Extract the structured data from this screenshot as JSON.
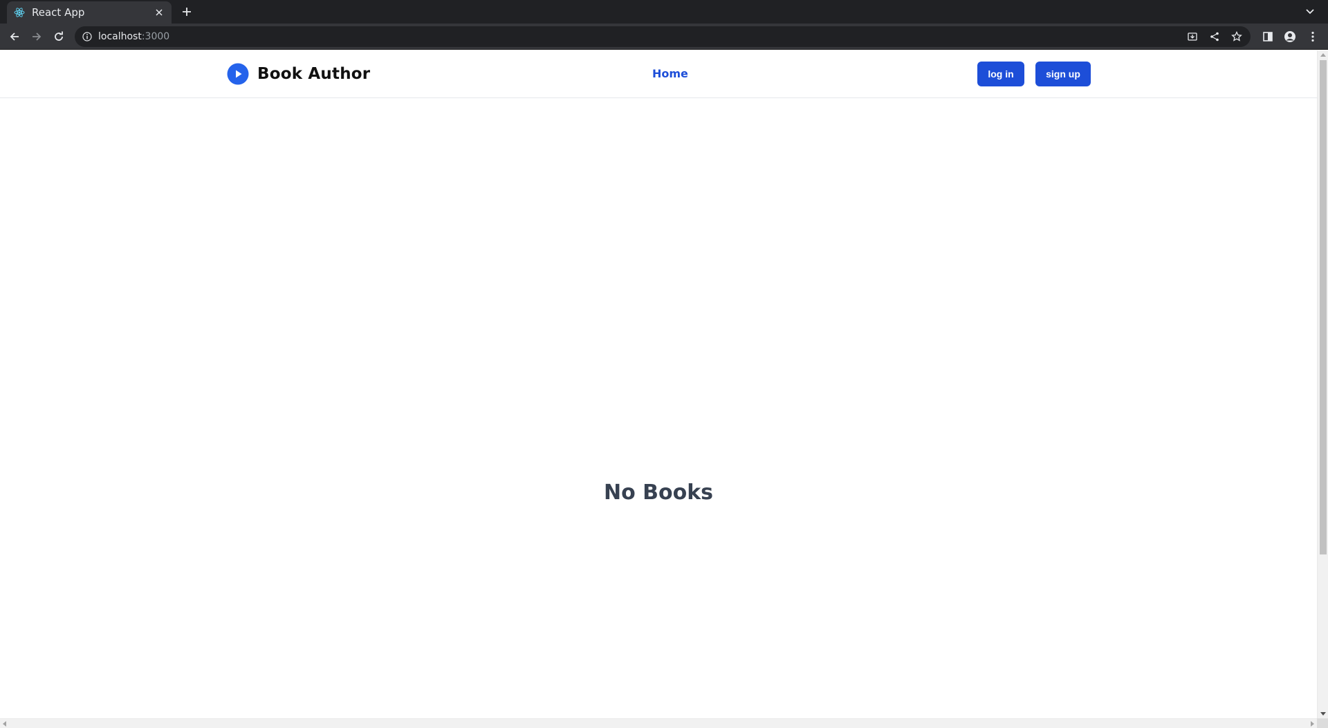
{
  "browser": {
    "tab": {
      "title": "React App",
      "favicon": "react-icon",
      "close_icon": "close-icon"
    },
    "new_tab_icon": "plus-icon",
    "tab_search_icon": "chevron-down-icon",
    "nav": {
      "back_icon": "arrow-left-icon",
      "forward_icon": "arrow-right-icon",
      "reload_icon": "reload-icon"
    },
    "address": {
      "host": "localhost",
      "port": ":3000",
      "info_icon": "info-icon"
    },
    "actions": [
      "install-icon",
      "share-icon",
      "star-icon",
      "side-panel-icon",
      "profile-icon",
      "kebab-menu-icon"
    ]
  },
  "navbar": {
    "brand_name": "Book Author",
    "brand_logo": "play-circle-icon",
    "links": {
      "home": "Home"
    },
    "login_label": "log in",
    "signup_label": "sign up"
  },
  "main": {
    "empty_message": "No Books"
  },
  "colors": {
    "accent": "#1d4ed8",
    "logo": "#2563eb",
    "heading": "#374151",
    "chrome_dark": "#202124",
    "chrome_toolbar": "#35363a"
  }
}
